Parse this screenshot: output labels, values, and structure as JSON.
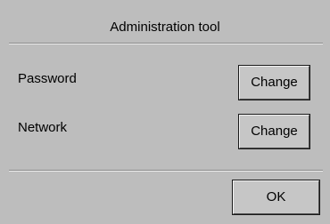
{
  "dialog": {
    "title": "Administration tool",
    "rows": [
      {
        "label": "Password",
        "button_label": "Change"
      },
      {
        "label": "Network",
        "button_label": "Change"
      }
    ],
    "ok_label": "OK"
  },
  "colors": {
    "background": "#bdbdbd",
    "button_face": "#c6c6c6"
  }
}
